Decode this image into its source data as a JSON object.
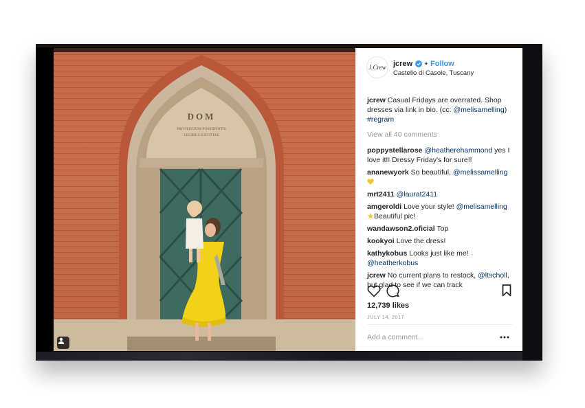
{
  "post": {
    "username": "jcrew",
    "follow_label": "Follow",
    "dot_separator": "•",
    "location": "Castello di Casole, Tuscany",
    "avatar_text": "J.Crew"
  },
  "photo": {
    "plaque_title": "DOM",
    "plaque_line1": "PRIVILEGIUM POSSIDENTIS",
    "plaque_line2": "LEGIBUS IUSTITIAE"
  },
  "caption": {
    "author": "jcrew",
    "text": "Casual Fridays are overrated. Shop dresses via link in bio. (cc: ",
    "mention": "@melisamelling",
    "close": ")",
    "hashtag": "#regram"
  },
  "view_all_comments": "View all 40 comments",
  "comments": [
    {
      "user": "poppystellarose",
      "mention": "@heatherehammond",
      "text": " yes I love it!! Dressy Friday's for sure!!"
    },
    {
      "user": "ananewyork",
      "text": " So beautiful, ",
      "mention": "@melissamelling"
    },
    {
      "user": "mrt2411",
      "mention": "@laurat2411"
    },
    {
      "user": "amgeroldi",
      "text": " Love your style! ",
      "mention": "@melisamelling",
      "text2": "Beautiful pic!"
    },
    {
      "user": "wandawson2.oficial",
      "text": " Top"
    },
    {
      "user": "kookyoi",
      "text": " Love the dress!"
    },
    {
      "user": "kathykobus",
      "text": " Looks just like me! ",
      "mention": "@heatherkobus"
    },
    {
      "user": "jcrew",
      "text": " No current plans to restock, ",
      "mention": "@ltscholl",
      "text2": ", but glad to see if we can track"
    }
  ],
  "likes": "12,739 likes",
  "date": "JULY 14, 2017",
  "add_comment_placeholder": "Add a comment...",
  "icons": {
    "like": "heart-outline-icon",
    "comment": "speech-bubble-icon",
    "save": "bookmark-icon",
    "more": "ellipsis-icon",
    "verified": "verified-badge-icon",
    "user_tag": "person-tag-icon"
  },
  "colors": {
    "follow": "#3897f0",
    "mention": "#003569",
    "muted": "#999999",
    "text": "#262626",
    "brick": "#c66a4a",
    "door": "#3e6a60",
    "dress": "#f2d218"
  }
}
